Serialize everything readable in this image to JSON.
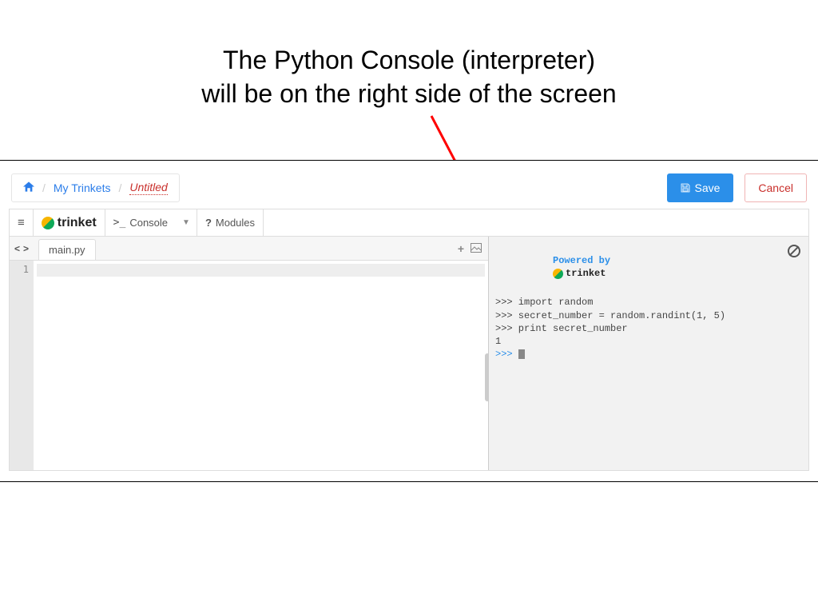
{
  "slide": {
    "title_line1": "The Python Console (interpreter)",
    "title_line2": "will be on the right side of the screen"
  },
  "breadcrumb": {
    "my_trinkets": "My Trinkets",
    "untitled": "Untitled",
    "sep": "/"
  },
  "buttons": {
    "save": "Save",
    "cancel": "Cancel"
  },
  "brand": "trinket",
  "toolbar": {
    "console": "Console",
    "modules": "Modules"
  },
  "tabs": {
    "filename": "main.py"
  },
  "editor": {
    "line1_no": "1"
  },
  "console": {
    "powered_by": "Powered by",
    "brand": "trinket",
    "lines": [
      ">>> import random",
      ">>> secret_number = random.randint(1, 5)",
      ">>> print secret_number",
      "1"
    ],
    "prompt": ">>> "
  }
}
